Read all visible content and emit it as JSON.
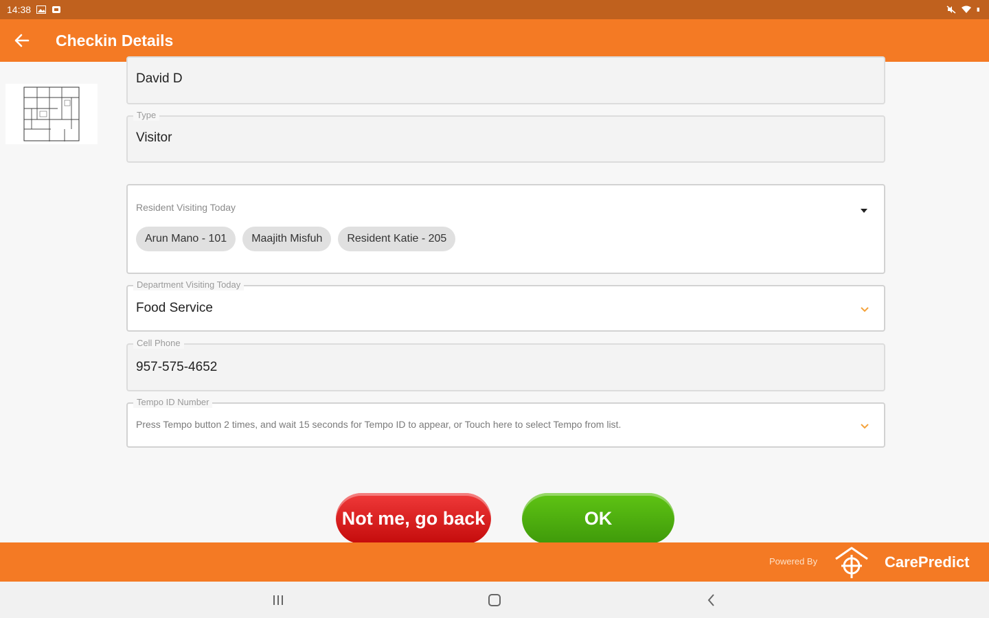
{
  "status_bar": {
    "time": "14:38",
    "icons": [
      "image-icon",
      "notification-icon",
      "mute-icon",
      "wifi-icon",
      "battery-icon"
    ]
  },
  "app_bar": {
    "title": "Checkin Details",
    "back_icon": "arrow-left-icon"
  },
  "form": {
    "name_value": "David D",
    "type_label": "Type",
    "type_value": "Visitor",
    "resident_label": "Resident Visiting Today",
    "residents": [
      "Arun Mano - 101",
      "Maajith Misfuh",
      "Resident Katie - 205"
    ],
    "department_label": "Department Visiting Today",
    "department_value": "Food Service",
    "phone_label": "Cell Phone",
    "phone_value": "957-575-4652",
    "tempo_label": "Tempo ID Number",
    "tempo_hint": "Press Tempo button 2 times, and wait 15 seconds for Tempo ID to appear, or Touch here to select Tempo from list."
  },
  "actions": {
    "back_label": "Not me, go back",
    "ok_label": "OK"
  },
  "footer": {
    "powered_by": "Powered By",
    "brand": "CarePredict"
  },
  "colors": {
    "primary": "#f47a24",
    "status_bar": "#c0611e",
    "back_button": "#d81414",
    "ok_button": "#52b010",
    "chevron": "#f4a23a"
  }
}
